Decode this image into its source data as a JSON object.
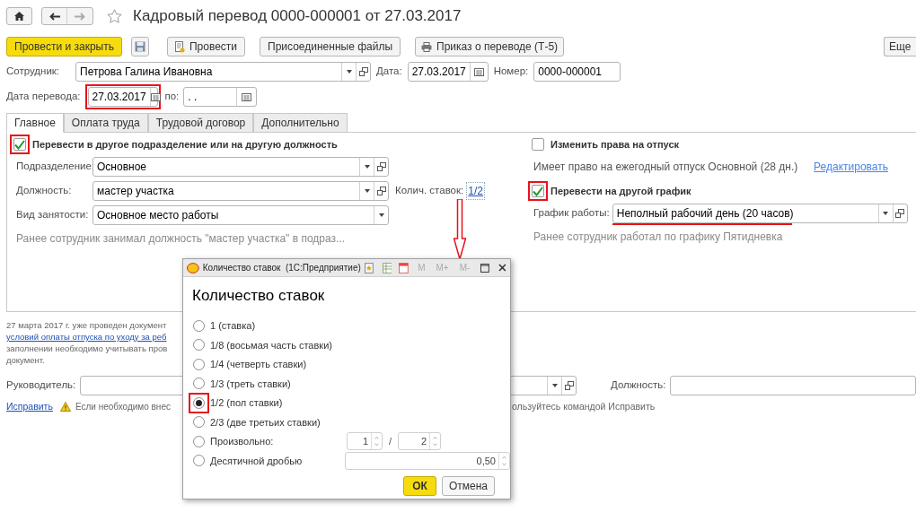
{
  "title": "Кадровый перевод 0000-000001 от 27.03.2017",
  "toolbar": [
    {
      "kind": "primary",
      "label": "Провести и закрыть"
    },
    {
      "kind": "save"
    },
    {
      "kind": "post",
      "label": "Провести"
    },
    {
      "kind": "plain",
      "label": "Присоединенные файлы"
    },
    {
      "kind": "print",
      "label": "Приказ о переводе (Т-5)"
    }
  ],
  "more_button": "Еще",
  "employee": {
    "label": "Сотрудник:",
    "value": "Петрова Галина Ивановна"
  },
  "date": {
    "label": "Дата:",
    "value": "27.03.2017"
  },
  "number": {
    "label": "Номер:",
    "value": "0000-000001"
  },
  "transfer_date": {
    "label": "Дата перевода:",
    "value": "27.03.2017",
    "highlighted": true
  },
  "until": {
    "label": "по:",
    "value": " .  ."
  },
  "tabs": [
    {
      "label": "Главное",
      "selected": true
    },
    {
      "label": "Оплата труда",
      "selected": false
    },
    {
      "label": "Трудовой договор",
      "selected": false
    },
    {
      "label": "Дополнительно",
      "selected": false
    }
  ],
  "position_section": {
    "checkbox": {
      "label": "Перевести в другое подразделение или на другую должность",
      "checked": true,
      "highlighted": true
    },
    "department": {
      "label": "Подразделение:",
      "value": "Основное"
    },
    "position": {
      "label": "Должность:",
      "value": "мастер участка"
    },
    "rate": {
      "label": "Колич. ставок:",
      "value": "1/2"
    },
    "employment": {
      "label": "Вид занятости:",
      "value": "Основное место работы"
    },
    "note": "Ранее сотрудник занимал должность \"мастер участка\" в подраз..."
  },
  "vacation_section": {
    "checkbox": {
      "label": "Изменить права на отпуск",
      "checked": false,
      "highlighted": false
    },
    "note": "Имеет право на ежегодный отпуск Основной (28 дн.)",
    "edit_link": "Редактировать"
  },
  "schedule_section": {
    "checkbox": {
      "label": "Перевести на другой график",
      "checked": true,
      "highlighted": true
    },
    "schedule": {
      "label": "График работы:",
      "value": "Неполный рабочий день (20 часов)",
      "underlined": true
    },
    "note": "Ранее сотрудник работал по графику Пятидневка"
  },
  "info": [
    {
      "kind": "text",
      "text": "27 марта 2017 г. уже проведен документ"
    },
    {
      "kind": "link",
      "text": "условий оплаты отпуска по уходу за реб"
    },
    {
      "kind": "text",
      "text": "заполнении необходимо учитывать пров"
    },
    {
      "kind": "text",
      "text": "документ."
    }
  ],
  "manager": {
    "label": "Руководитель:"
  },
  "manager_position": {
    "label": "Должность:"
  },
  "fix_link": "Исправить",
  "warning_left": "Если необходимо внес",
  "warning_right": "ользуйтесь командой Исправить",
  "dialog": {
    "title": "Количество ставок  (1С:Предприятие)",
    "memory_buttons": [
      "M",
      "M+",
      "M-"
    ],
    "heading": "Количество ставок",
    "options": [
      {
        "label": "1 (ставка)",
        "selected": false,
        "highlighted": false
      },
      {
        "label": "1/8 (восьмая часть ставки)",
        "selected": false,
        "highlighted": false
      },
      {
        "label": "1/4 (четверть ставки)",
        "selected": false,
        "highlighted": false
      },
      {
        "label": "1/3 (треть ставки)",
        "selected": false,
        "highlighted": false
      },
      {
        "label": "1/2 (пол ставки)",
        "selected": true,
        "highlighted": true
      },
      {
        "label": "2/3 (две третьих ставки)",
        "selected": false,
        "highlighted": false
      },
      {
        "label": "Произвольно:",
        "selected": false,
        "highlighted": false,
        "kind": "fraction",
        "numerator": "1",
        "separator": "/",
        "denominator": "2"
      },
      {
        "label": "Десятичной дробью",
        "selected": false,
        "highlighted": false,
        "kind": "decimal",
        "value": "0,50"
      }
    ],
    "ok": "ОК",
    "cancel": "Отмена"
  }
}
